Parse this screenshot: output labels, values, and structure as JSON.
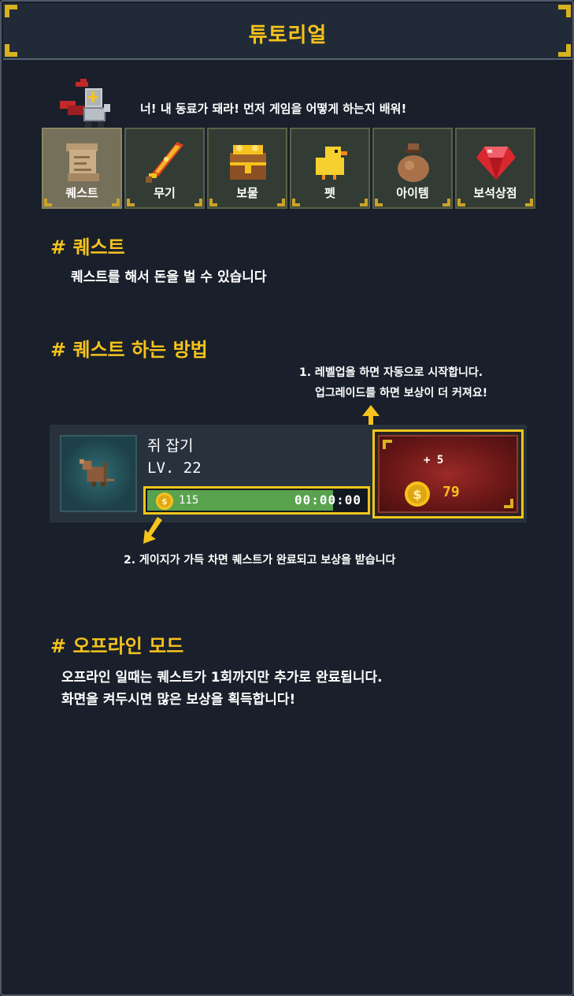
{
  "header": {
    "title": "튜토리얼"
  },
  "intro": {
    "text": "너! 내 동료가 돼라!  먼저 게임을 어떻게 하는지 배워!"
  },
  "tabs": [
    {
      "label": "퀘스트",
      "icon": "scroll-icon",
      "active": true
    },
    {
      "label": "무기",
      "icon": "flame-sword-icon",
      "active": false
    },
    {
      "label": "보물",
      "icon": "treasure-chest-icon",
      "active": false
    },
    {
      "label": "펫",
      "icon": "chick-icon",
      "active": false
    },
    {
      "label": "아이템",
      "icon": "money-bag-icon",
      "active": false
    },
    {
      "label": "보석상점",
      "icon": "ruby-icon",
      "active": false
    }
  ],
  "section_quest": {
    "title": "# 퀘스트",
    "body": "퀘스트를 해서 돈을 벌 수 있습니다"
  },
  "section_howto": {
    "title": "# 퀘스트 하는 방법",
    "hint1_line1": "1. 레벨업을 하면 자동으로 시작합니다.",
    "hint1_line2": "업그레이드를 하면 보상이 더 커져요!",
    "hint2": "2. 게이지가 가득 차면 퀘스트가 완료되고 보상을 받습니다"
  },
  "quest_card": {
    "name": "쥐 잡기",
    "level": "LV. 22",
    "progress_value": "115",
    "progress_fraction": 0.85,
    "timer": "00:00:00",
    "reward_plus": "+ 5",
    "reward_amount": "79"
  },
  "section_offline": {
    "title": "# 오프라인 모드",
    "body_line1": "오프라인 일때는 퀘스트가 1회까지만 추가로 완료됩니다.",
    "body_line2": "화면을 켜두시면 많은 보상을 획득합니다!"
  },
  "colors": {
    "accent_gold": "#f6c21c",
    "background": "#19202b",
    "progress_green": "#59a24e",
    "reward_red": "#7a1a1a"
  }
}
